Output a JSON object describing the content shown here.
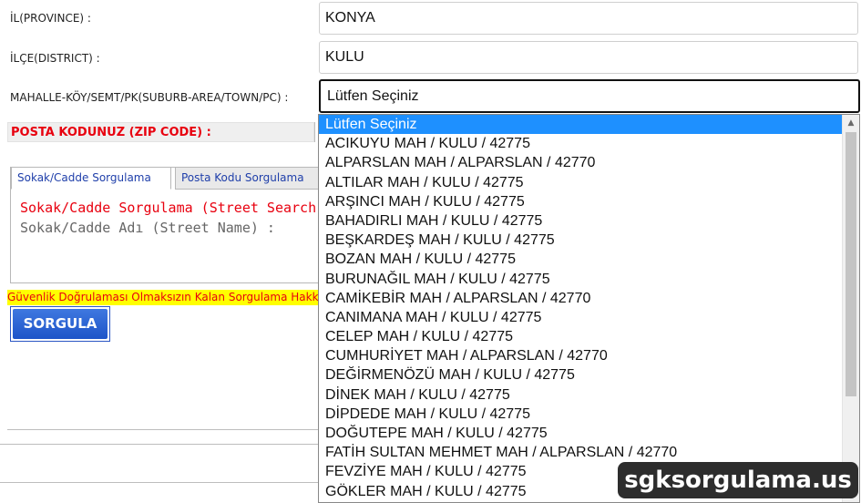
{
  "form": {
    "province_label": "İL(PROVINCE) :",
    "province_value": "KONYA",
    "district_label": "İLÇE(DISTRICT) :",
    "district_value": "KULU",
    "neighborhood_label": "MAHALLE-KÖY/SEMT/PK(SUBURB-AREA/TOWN/PC) :",
    "neighborhood_selected": "Lütfen Seçiniz",
    "zip_label": "POSTA KODUNUZ (ZIP CODE) :"
  },
  "tabs": [
    {
      "label": "Sokak/Cadde Sorgulama",
      "active": true
    },
    {
      "label": "Posta Kodu Sorgulama",
      "active": false
    }
  ],
  "panel": {
    "title": "Sokak/Cadde Sorgulama (Street Search)",
    "street_label": "Sokak/Cadde Adı (Street Name) :"
  },
  "warning": "Güvenlik Doğrulaması Olmaksızın Kalan Sorgulama Hakkınız",
  "query_button": "SORGULA",
  "dropdown": {
    "options": [
      "Lütfen Seçiniz",
      "ACIKUYU MAH / KULU / 42775",
      "ALPARSLAN MAH / ALPARSLAN / 42770",
      "ALTILAR MAH / KULU / 42775",
      "ARŞINCI MAH / KULU / 42775",
      "BAHADIRLI MAH / KULU / 42775",
      "BEŞKARDEŞ MAH / KULU / 42775",
      "BOZAN MAH / KULU / 42775",
      "BURUNAĞIL MAH / KULU / 42775",
      "CAMİKEBİR MAH / ALPARSLAN / 42770",
      "CANIMANA MAH / KULU / 42775",
      "CELEP MAH / KULU / 42775",
      "CUMHURİYET MAH / ALPARSLAN / 42770",
      "DEĞİRMENÖZÜ MAH / KULU / 42775",
      "DİNEK MAH / KULU / 42775",
      "DİPDEDE MAH / KULU / 42775",
      "DOĞUTEPE MAH / KULU / 42775",
      "FATİH SULTAN MEHMET MAH / ALPARSLAN / 42770",
      "FEVZİYE MAH / KULU / 42775",
      "GÖKLER MAH / KULU / 42775"
    ],
    "selected_index": 0
  },
  "watermark": "sgksorgulama.us",
  "colors": {
    "label_red": "#e8000f",
    "selected_option": "#1e90ff",
    "button_blue": "#1d54c8",
    "warning_bg": "#ffff00"
  }
}
